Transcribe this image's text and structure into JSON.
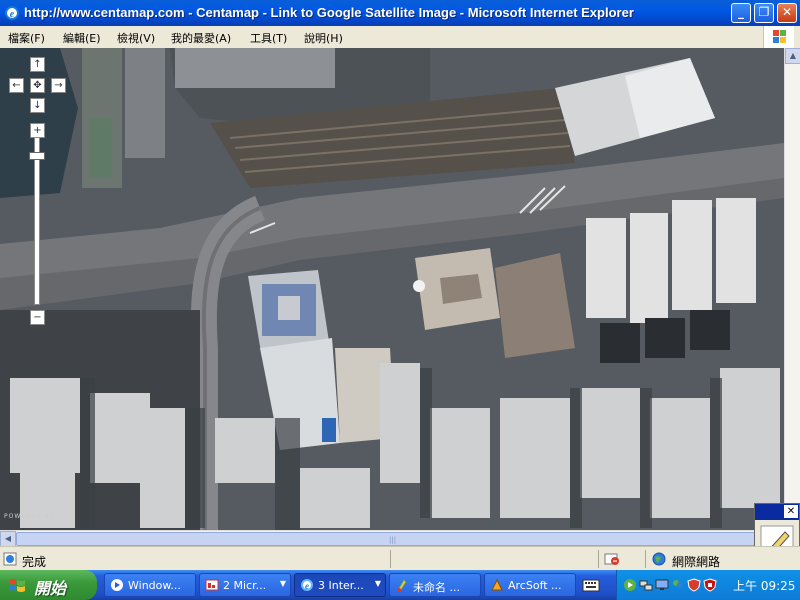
{
  "window": {
    "title": "http://www.centamap.com - Centamap - Link to Google Satellite Image - Microsoft Internet Explorer",
    "minimize_glyph": "_",
    "maximize_glyph": "❐",
    "close_glyph": "✕"
  },
  "menu": {
    "items": [
      {
        "label": "檔案(F)"
      },
      {
        "label": "編輯(E)"
      },
      {
        "label": "檢視(V)"
      },
      {
        "label": "我的最愛(A)"
      },
      {
        "label": "工具(T)"
      },
      {
        "label": "說明(H)"
      }
    ],
    "logo_icon": "windows-flag-icon"
  },
  "map": {
    "controls": {
      "pan_up": "↑",
      "pan_left": "←",
      "pan_center": "✥",
      "pan_right": "→",
      "pan_down": "↓",
      "zoom_in": "+",
      "zoom_out": "−"
    },
    "zoom_level_fraction": 0.92,
    "powered_by": "POWERED BY",
    "inset_close": "✕"
  },
  "status": {
    "text": "完成",
    "zone": "網際網路"
  },
  "taskbar": {
    "start_label": "開始",
    "items": [
      {
        "label": "Window...",
        "icon": "media-player-icon"
      },
      {
        "label": "2 Micr...",
        "icon": "presentation-icon"
      },
      {
        "label": "3 Inter...",
        "icon": "ie-icon"
      },
      {
        "label": "未命名 ...",
        "icon": "paint-icon"
      },
      {
        "label": "ArcSoft ...",
        "icon": "arcsoft-icon"
      }
    ],
    "clock": "上午 09:25"
  },
  "colors": {
    "titlebar": "#0058e6",
    "taskbar": "#245edb",
    "start_green": "#3c9a3c",
    "tray_blue": "#0e8ae0"
  }
}
